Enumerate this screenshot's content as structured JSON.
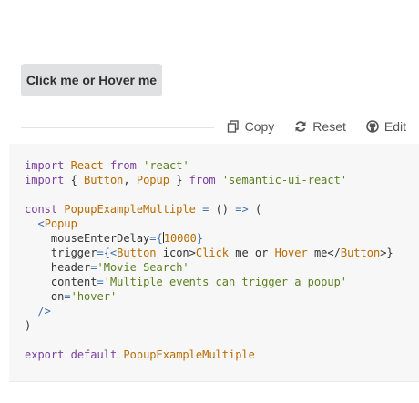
{
  "demo": {
    "button_label": "Click me or Hover me"
  },
  "toolbar": {
    "copy_label": "Copy",
    "reset_label": "Reset",
    "edit_label": "Edit"
  },
  "code": {
    "l1": [
      "import",
      "React",
      "from",
      "'react'"
    ],
    "l2": [
      "import",
      "{ ",
      "Button",
      ", ",
      "Popup",
      " }",
      "from",
      "'semantic-ui-react'"
    ],
    "l4": [
      "const",
      "PopupExampleMultiple",
      "=",
      "()",
      "=>",
      "("
    ],
    "l5": [
      "<",
      "Popup"
    ],
    "l6": [
      "mouseEnterDelay",
      "={",
      "10000",
      "}"
    ],
    "l7": [
      "trigger",
      "={<",
      "Button",
      " icon>",
      "Click",
      " me or ",
      "Hover",
      " me</",
      "Button",
      ">}"
    ],
    "l8": [
      "header",
      "=",
      "'Movie Search'"
    ],
    "l9": [
      "content",
      "=",
      "'Multiple events can trigger a popup'"
    ],
    "l10": [
      "on",
      "=",
      "'hover'"
    ],
    "l11": [
      "/>"
    ],
    "l12": [
      ")"
    ],
    "l14": [
      "export",
      "default",
      "PopupExampleMultiple"
    ]
  }
}
